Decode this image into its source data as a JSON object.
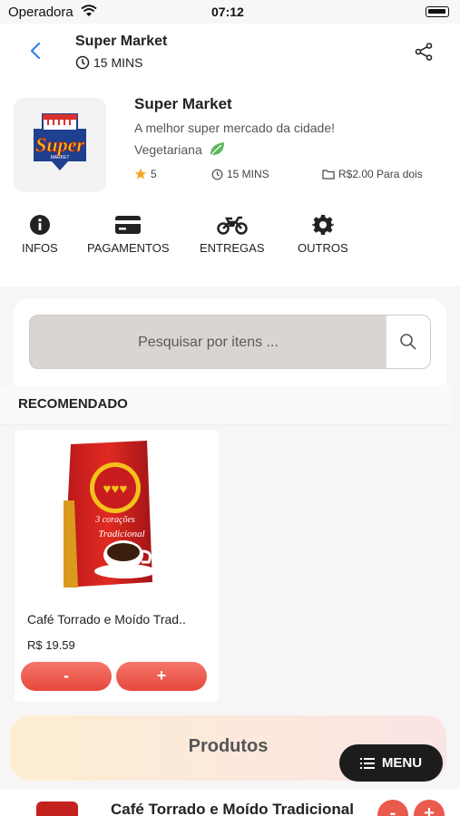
{
  "status": {
    "carrier": "Operadora",
    "time": "07:12"
  },
  "header": {
    "title": "Super Market",
    "time": "15 MINS"
  },
  "store": {
    "name": "Super Market",
    "description": "A melhor super mercado da cidade!",
    "type": "Vegetariana",
    "rating": "5",
    "time": "15 MINS",
    "price": "R$2.00 Para dois",
    "logo_text": "Super"
  },
  "tabs": [
    {
      "label": "INFOS",
      "icon": "info-icon"
    },
    {
      "label": "PAGAMENTOS",
      "icon": "card-icon"
    },
    {
      "label": "ENTREGAS",
      "icon": "motorcycle-icon"
    },
    {
      "label": "OUTROS",
      "icon": "gear-icon"
    }
  ],
  "search": {
    "placeholder": "Pesquisar por itens ..."
  },
  "recommended": {
    "title": "RECOMENDADO",
    "product": {
      "name": "Café Torrado e Moído Trad..",
      "price": "R$ 19.59",
      "minus": "-",
      "plus": "+",
      "brand": "3 corações",
      "variant": "Tradicional"
    }
  },
  "products_bar": {
    "label": "Produtos"
  },
  "menu_button": {
    "label": "MENU"
  },
  "list_item": {
    "name": "Café Torrado e Moído Tradicional",
    "minus": "-",
    "plus": "+"
  },
  "colors": {
    "accent": "#e8483c",
    "star": "#f5a623",
    "leaf": "#5cb85c",
    "link": "#2f80ed"
  }
}
